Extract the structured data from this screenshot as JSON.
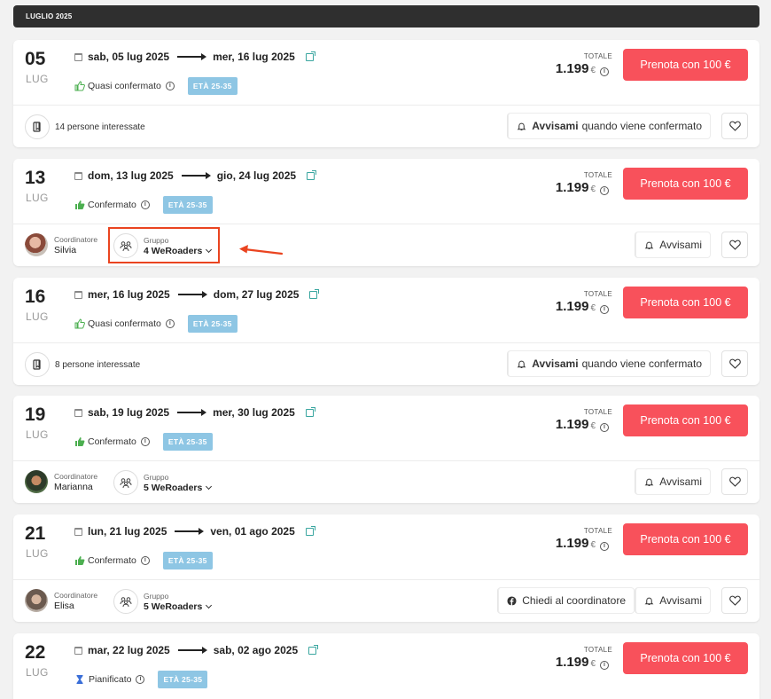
{
  "month_label": "LUGLIO 2025",
  "labels": {
    "totale": "TOTALE",
    "currency": "€",
    "coordinator": "Coordinatore",
    "group": "Gruppo",
    "info": "i"
  },
  "colors": {
    "book_button": "#f8515b",
    "age_badge": "#8ec6e4",
    "confirmed_green": "#4caf50",
    "highlight": "#ea4420",
    "month_bar": "#2f2f2f"
  },
  "trips": [
    {
      "day": "05",
      "month": "LUG",
      "start": "sab, 05 lug 2025",
      "end": "mer, 16 lug 2025",
      "status": "Quasi confermato",
      "status_icon": "thumb-outline-icon",
      "age": "ETÀ 25-35",
      "price": "1.199",
      "book": "Prenota con 100 €",
      "interested": "14 persone interessate",
      "notify_bold": "Avvisami",
      "notify_rest": "quando viene confermato"
    },
    {
      "day": "13",
      "month": "LUG",
      "start": "dom, 13 lug 2025",
      "end": "gio, 24 lug 2025",
      "status": "Confermato",
      "status_icon": "thumb-filled-icon",
      "age": "ETÀ 25-35",
      "price": "1.199",
      "book": "Prenota con 100 €",
      "coordinator_name": "Silvia",
      "group_name": "4 WeRoaders",
      "notify": "Avvisami"
    },
    {
      "day": "16",
      "month": "LUG",
      "start": "mer, 16 lug 2025",
      "end": "dom, 27 lug 2025",
      "status": "Quasi confermato",
      "status_icon": "thumb-outline-icon",
      "age": "ETÀ 25-35",
      "price": "1.199",
      "book": "Prenota con 100 €",
      "interested": "8 persone interessate",
      "notify_bold": "Avvisami",
      "notify_rest": "quando viene confermato"
    },
    {
      "day": "19",
      "month": "LUG",
      "start": "sab, 19 lug 2025",
      "end": "mer, 30 lug 2025",
      "status": "Confermato",
      "status_icon": "thumb-filled-icon",
      "age": "ETÀ 25-35",
      "price": "1.199",
      "book": "Prenota con 100 €",
      "coordinator_name": "Marianna",
      "group_name": "5 WeRoaders",
      "notify": "Avvisami"
    },
    {
      "day": "21",
      "month": "LUG",
      "start": "lun, 21 lug 2025",
      "end": "ven, 01 ago 2025",
      "status": "Confermato",
      "status_icon": "thumb-filled-icon",
      "age": "ETÀ 25-35",
      "price": "1.199",
      "book": "Prenota con 100 €",
      "coordinator_name": "Elisa",
      "group_name": "5 WeRoaders",
      "ask": "Chiedi al coordinatore",
      "notify": "Avvisami"
    },
    {
      "day": "22",
      "month": "LUG",
      "start": "mar, 22 lug 2025",
      "end": "sab, 02 ago 2025",
      "status": "Pianificato",
      "status_icon": "hourglass-icon",
      "age": "ETÀ 25-35",
      "price": "1.199",
      "book": "Prenota con 100 €"
    }
  ]
}
